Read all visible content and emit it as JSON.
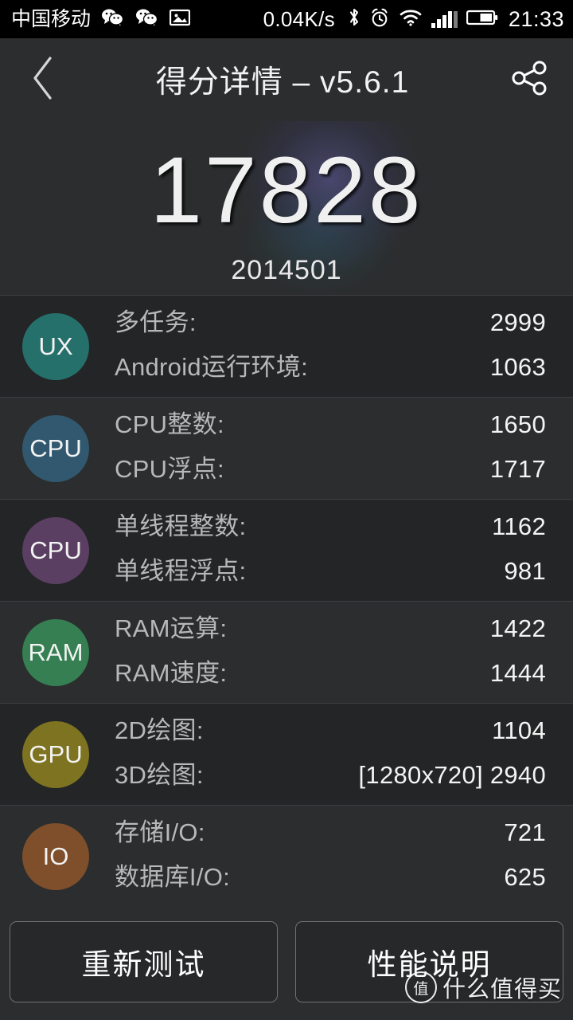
{
  "statusbar": {
    "carrier": "中国移动",
    "network_speed": "0.04K/s",
    "clock": "21:33",
    "icons": [
      "wechat-icon",
      "wechat-icon",
      "image-icon",
      "bluetooth-icon",
      "alarm-icon",
      "wifi-icon",
      "signal-icon",
      "battery-icon"
    ]
  },
  "header": {
    "back_icon": "chevron-left-icon",
    "title": "得分详情 – v5.6.1",
    "share_icon": "share-icon"
  },
  "score": {
    "total": "17828",
    "sub": "2014501"
  },
  "groups": [
    {
      "badge": "UX",
      "color": "#26706b",
      "metrics": [
        {
          "label": "多任务:",
          "value": "2999"
        },
        {
          "label": "Android运行环境:",
          "value": "1063"
        }
      ]
    },
    {
      "badge": "CPU",
      "color": "#31586f",
      "metrics": [
        {
          "label": "CPU整数:",
          "value": "1650"
        },
        {
          "label": "CPU浮点:",
          "value": "1717"
        }
      ]
    },
    {
      "badge": "CPU",
      "color": "#5b3f62",
      "metrics": [
        {
          "label": "单线程整数:",
          "value": "1162"
        },
        {
          "label": "单线程浮点:",
          "value": "981"
        }
      ]
    },
    {
      "badge": "RAM",
      "color": "#357f52",
      "metrics": [
        {
          "label": "RAM运算:",
          "value": "1422"
        },
        {
          "label": "RAM速度:",
          "value": "1444"
        }
      ]
    },
    {
      "badge": "GPU",
      "color": "#7d7320",
      "metrics": [
        {
          "label": "2D绘图:",
          "value": "1104"
        },
        {
          "label": "3D绘图:",
          "value": "[1280x720] 2940"
        }
      ]
    },
    {
      "badge": "IO",
      "color": "#7e4f2a",
      "metrics": [
        {
          "label": "存储I/O:",
          "value": "721"
        },
        {
          "label": "数据库I/O:",
          "value": "625"
        }
      ]
    }
  ],
  "footer": {
    "retest_label": "重新测试",
    "explain_label": "性能说明"
  },
  "watermark": {
    "mark": "值",
    "text": "什么值得买"
  }
}
